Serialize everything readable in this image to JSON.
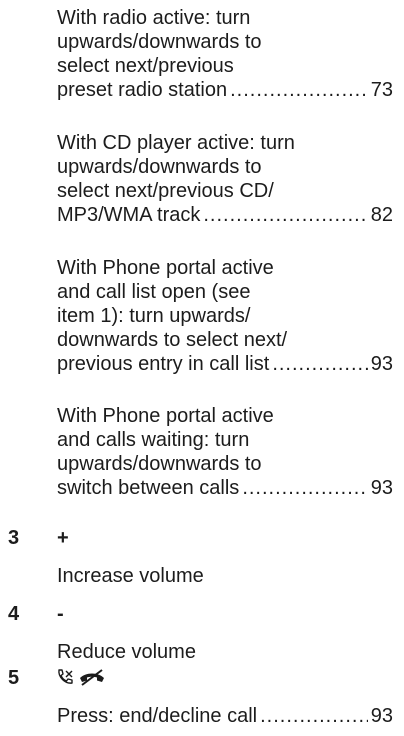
{
  "entries": [
    {
      "lines": [
        "With radio active: turn",
        "upwards/downwards to",
        "select next/previous"
      ],
      "ref_text": "preset radio station",
      "page": "73"
    },
    {
      "lines": [
        "With CD player active: turn",
        "upwards/downwards to",
        "select next/previous CD/"
      ],
      "ref_text": "MP3/WMA track",
      "page": "82"
    },
    {
      "lines": [
        "With Phone portal active",
        "and call list open (see",
        "item 1): turn upwards/",
        "downwards to select next/"
      ],
      "ref_text": "previous entry in call list",
      "page": "93"
    },
    {
      "lines": [
        "With Phone portal active",
        "and calls waiting: turn",
        "upwards/downwards to"
      ],
      "ref_text": "switch between calls",
      "page": "93"
    }
  ],
  "items": [
    {
      "number": "3",
      "symbol": "+",
      "description": "Increase volume"
    },
    {
      "number": "4",
      "symbol": "-",
      "description": "Reduce volume"
    },
    {
      "number": "5",
      "symbol_icons": [
        "phone-cross-icon",
        "phone-hangup-icon"
      ]
    }
  ],
  "final_entry": {
    "ref_text": "Press: end/decline call",
    "page": "93"
  },
  "leader_dots": "...................................................................................."
}
